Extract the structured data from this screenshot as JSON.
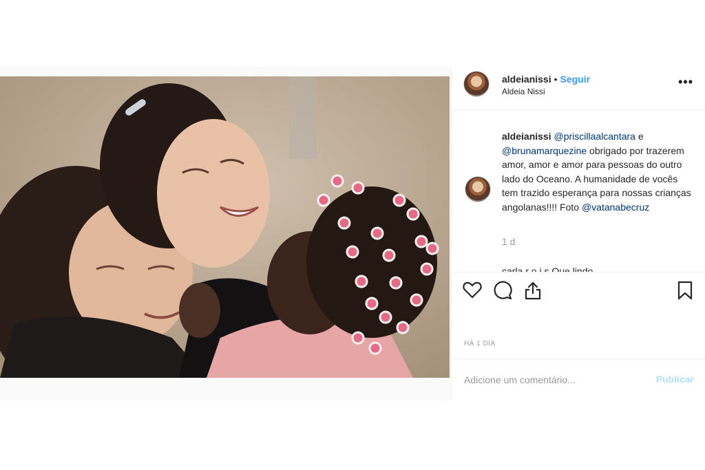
{
  "post": {
    "photo_alt": "",
    "header": {
      "username": "aldeianissi",
      "separator": "•",
      "follow_label": "Seguir",
      "location": "Aldeia Nissi",
      "more_icon": "more-options-icon"
    },
    "caption": {
      "username": "aldeianissi",
      "mention1": "@priscillaalcantara",
      "text1": " e ",
      "mention2": "@brunamarquezine",
      "text2": " obrigado por trazerem amor, amor e amor para pessoas do outro lado do Oceano. A humanidade de vocês tem trazido esperança para nossas crianças angolanas!!!! Foto ",
      "mention3": "@vatanabecruz",
      "time": "1 d"
    },
    "next_comment_peek": "carla r o i s Que lindo",
    "actions": {
      "like_icon": "heart-icon",
      "comment_icon": "comment-icon",
      "share_icon": "share-icon",
      "save_icon": "bookmark-icon"
    },
    "date": "HÁ 1 DIA",
    "comment_box": {
      "placeholder": "Adicione um comentário...",
      "publish_label": "Publicar"
    }
  }
}
